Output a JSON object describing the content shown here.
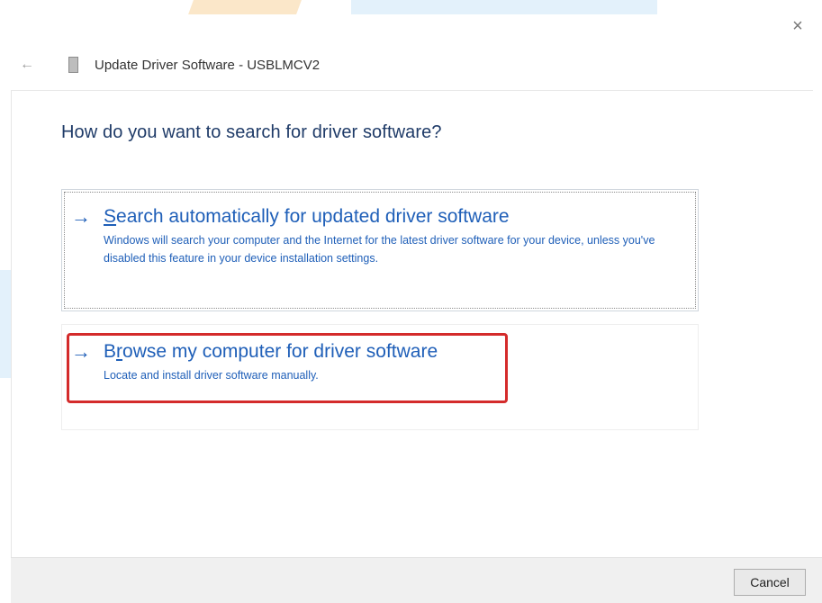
{
  "window": {
    "title": "Update Driver Software - USBLMCV2",
    "close_glyph": "×",
    "back_glyph": "←"
  },
  "heading": "How do you want to search for driver software?",
  "options": [
    {
      "arrow": "→",
      "title_first_letter": "S",
      "title_rest": "earch automatically for updated driver software",
      "description": "Windows will search your computer and the Internet for the latest driver software for your device, unless you've disabled this feature in your device installation settings."
    },
    {
      "arrow": "→",
      "title_first_letter": "B",
      "title_second_letter": "r",
      "title_rest": "owse my computer for driver software",
      "description": "Locate and install driver software manually."
    }
  ],
  "footer": {
    "cancel_label": "Cancel"
  },
  "colors": {
    "accent": "#1f5fb8",
    "heading": "#1f3b68",
    "highlight": "#d42b2b"
  }
}
